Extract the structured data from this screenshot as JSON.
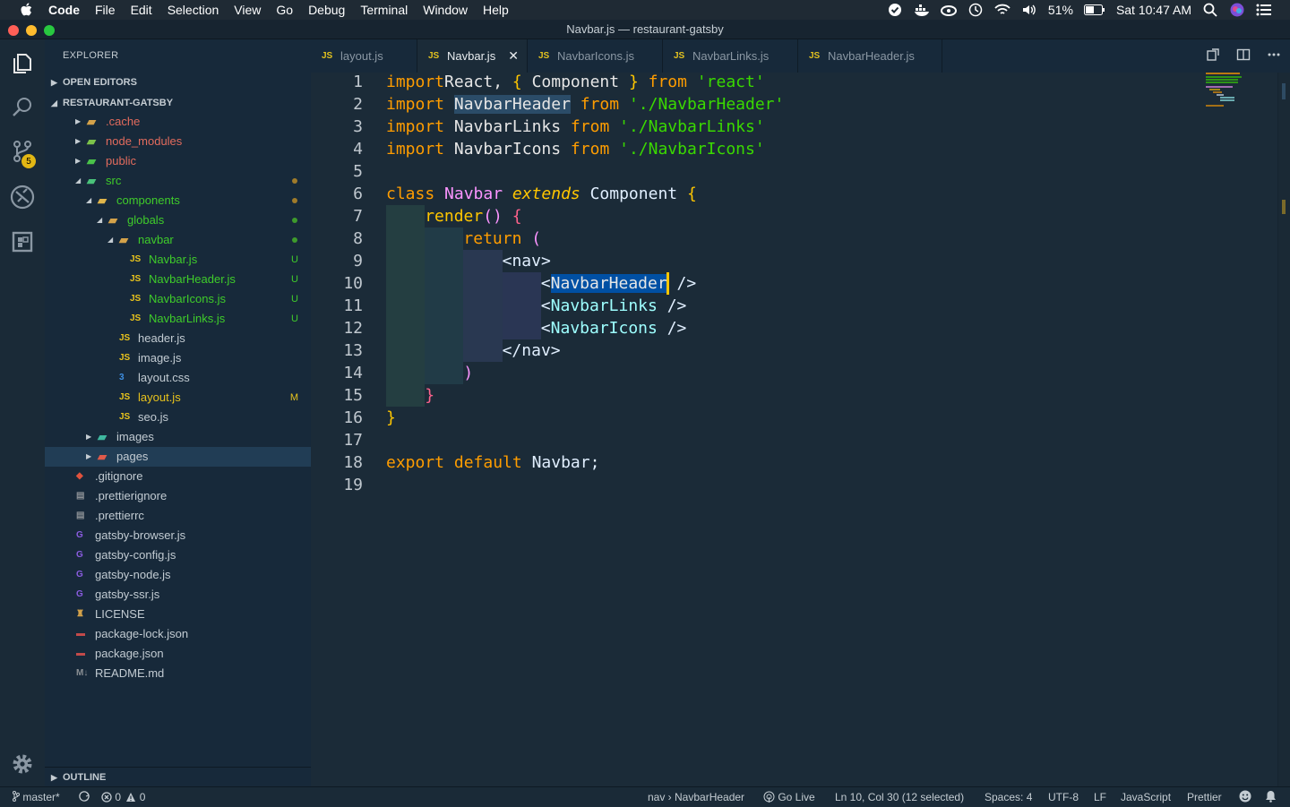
{
  "menubar": {
    "app": "Code",
    "items": [
      "File",
      "Edit",
      "Selection",
      "View",
      "Go",
      "Debug",
      "Terminal",
      "Window",
      "Help"
    ],
    "battery": "51%",
    "clock": "Sat 10:47 AM"
  },
  "window": {
    "title": "Navbar.js — restaurant-gatsby"
  },
  "activity": {
    "scm_badge": "5"
  },
  "explorer": {
    "title": "EXPLORER",
    "open_editors": "OPEN EDITORS",
    "project": "RESTAURANT-GATSBY",
    "outline": "OUTLINE",
    "tree": [
      {
        "name": ".cache",
        "icon": "folder-icon",
        "color": "#e26b5d",
        "expand": "closed",
        "status": "",
        "dot": ""
      },
      {
        "name": "node_modules",
        "icon": "node-folder-icon",
        "color": "#e26b5d",
        "expand": "closed",
        "status": "",
        "dot": ""
      },
      {
        "name": "public",
        "icon": "public-folder-icon",
        "color": "#e26b5d",
        "expand": "closed",
        "status": "",
        "dot": ""
      },
      {
        "name": "src",
        "icon": "src-folder-icon",
        "color": "#3fcc2a",
        "expand": "open",
        "status": "",
        "dot": "#a07b2a"
      },
      {
        "name": "components",
        "icon": "components-folder-icon",
        "color": "#3fcc2a",
        "expand": "open",
        "status": "",
        "dot": "#a07b2a"
      },
      {
        "name": "globals",
        "icon": "folder-icon",
        "color": "#3fcc2a",
        "expand": "open",
        "status": "",
        "dot": "#3e9a2c"
      },
      {
        "name": "navbar",
        "icon": "folder-icon",
        "color": "#3fcc2a",
        "expand": "open",
        "status": "",
        "dot": "#3e9a2c"
      },
      {
        "name": "Navbar.js",
        "icon": "js-file-icon",
        "color": "#3fcc2a",
        "expand": "",
        "status": "U",
        "dot": ""
      },
      {
        "name": "NavbarHeader.js",
        "icon": "js-file-icon",
        "color": "#3fcc2a",
        "expand": "",
        "status": "U",
        "dot": ""
      },
      {
        "name": "NavbarIcons.js",
        "icon": "js-file-icon",
        "color": "#3fcc2a",
        "expand": "",
        "status": "U",
        "dot": ""
      },
      {
        "name": "NavbarLinks.js",
        "icon": "js-file-icon",
        "color": "#3fcc2a",
        "expand": "",
        "status": "U",
        "dot": ""
      },
      {
        "name": "header.js",
        "icon": "js-file-icon",
        "color": "#c2cbd2",
        "expand": "",
        "status": "",
        "dot": ""
      },
      {
        "name": "image.js",
        "icon": "js-file-icon",
        "color": "#c2cbd2",
        "expand": "",
        "status": "",
        "dot": ""
      },
      {
        "name": "layout.css",
        "icon": "css-file-icon",
        "color": "#c2cbd2",
        "expand": "",
        "status": "",
        "dot": ""
      },
      {
        "name": "layout.js",
        "icon": "js-file-icon",
        "color": "#e8c31d",
        "expand": "",
        "status": "M",
        "dot": ""
      },
      {
        "name": "seo.js",
        "icon": "js-file-icon",
        "color": "#c2cbd2",
        "expand": "",
        "status": "",
        "dot": ""
      },
      {
        "name": "images",
        "icon": "images-folder-icon",
        "color": "#c2cbd2",
        "expand": "closed",
        "status": "",
        "dot": ""
      },
      {
        "name": "pages",
        "icon": "pages-folder-icon",
        "color": "#c2cbd2",
        "expand": "closed",
        "status": "",
        "dot": ""
      },
      {
        "name": ".gitignore",
        "icon": "git-icon",
        "color": "#c2cbd2",
        "expand": "",
        "status": "",
        "dot": ""
      },
      {
        "name": ".prettierignore",
        "icon": "prettier-icon",
        "color": "#c2cbd2",
        "expand": "",
        "status": "",
        "dot": ""
      },
      {
        "name": ".prettierrc",
        "icon": "prettier-icon",
        "color": "#c2cbd2",
        "expand": "",
        "status": "",
        "dot": ""
      },
      {
        "name": "gatsby-browser.js",
        "icon": "gatsby-icon",
        "color": "#c2cbd2",
        "expand": "",
        "status": "",
        "dot": ""
      },
      {
        "name": "gatsby-config.js",
        "icon": "gatsby-icon",
        "color": "#c2cbd2",
        "expand": "",
        "status": "",
        "dot": ""
      },
      {
        "name": "gatsby-node.js",
        "icon": "gatsby-icon",
        "color": "#c2cbd2",
        "expand": "",
        "status": "",
        "dot": ""
      },
      {
        "name": "gatsby-ssr.js",
        "icon": "gatsby-icon",
        "color": "#c2cbd2",
        "expand": "",
        "status": "",
        "dot": ""
      },
      {
        "name": "LICENSE",
        "icon": "license-icon",
        "color": "#c2cbd2",
        "expand": "",
        "status": "",
        "dot": ""
      },
      {
        "name": "package-lock.json",
        "icon": "npm-icon",
        "color": "#c2cbd2",
        "expand": "",
        "status": "",
        "dot": ""
      },
      {
        "name": "package.json",
        "icon": "npm-icon",
        "color": "#c2cbd2",
        "expand": "",
        "status": "",
        "dot": ""
      },
      {
        "name": "README.md",
        "icon": "markdown-icon",
        "color": "#c2cbd2",
        "expand": "",
        "status": "",
        "dot": ""
      }
    ]
  },
  "tabs": [
    {
      "label": "layout.js",
      "active": false
    },
    {
      "label": "Navbar.js",
      "active": true
    },
    {
      "label": "NavbarIcons.js",
      "active": false
    },
    {
      "label": "NavbarLinks.js",
      "active": false
    },
    {
      "label": "NavbarHeader.js",
      "active": false
    }
  ],
  "code": {
    "line_numbers": [
      "1",
      "2",
      "3",
      "4",
      "5",
      "6",
      "7",
      "8",
      "9",
      "10",
      "11",
      "12",
      "13",
      "14",
      "15",
      "16",
      "17",
      "18",
      "19"
    ],
    "lines": [
      [
        [
          "kw",
          "import"
        ],
        [
          "",
          "React, "
        ],
        [
          "brp",
          "{"
        ],
        [
          "",
          ""
        ],
        [
          "",
          "Component "
        ],
        [
          "brp",
          "}"
        ],
        [
          "kw",
          " from"
        ],
        [
          "str",
          " 'react'"
        ]
      ],
      [
        [
          "kw",
          "import"
        ],
        [
          "",
          ""
        ],
        [
          "hlw",
          "NavbarHeader"
        ],
        [
          "kw",
          " from"
        ],
        [
          "str",
          " './NavbarHeader'"
        ]
      ],
      [
        [
          "kw",
          "import"
        ],
        [
          "",
          ""
        ],
        [
          "",
          "NavbarLinks"
        ],
        [
          "kw",
          " from"
        ],
        [
          "str",
          " './NavbarLinks'"
        ]
      ],
      [
        [
          "kw",
          "import"
        ],
        [
          "",
          ""
        ],
        [
          "",
          "NavbarIcons"
        ],
        [
          "kw",
          " from"
        ],
        [
          "str",
          " './NavbarIcons'"
        ]
      ],
      [],
      [
        [
          "kw",
          "class"
        ],
        [
          "cls",
          " Navbar"
        ],
        [
          "ext",
          " extends"
        ],
        [
          "pun",
          " Component"
        ],
        [
          "brp",
          " {"
        ]
      ],
      [
        [
          "fn",
          "render"
        ],
        [
          "cls",
          "()"
        ],
        [
          "brpu",
          " {"
        ]
      ],
      [
        [
          "kw",
          "return"
        ],
        [
          "cls",
          " ("
        ]
      ],
      [
        [
          "pun",
          "<"
        ],
        [
          "pun",
          "nav"
        ],
        [
          "pun",
          ">"
        ]
      ],
      [
        [
          "pun",
          "<"
        ],
        [
          "sel",
          "NavbarHeader"
        ],
        [
          "pun",
          " />"
        ]
      ],
      [
        [
          "pun",
          "<"
        ],
        [
          "tag",
          "NavbarLinks"
        ],
        [
          "pun",
          " />"
        ]
      ],
      [
        [
          "pun",
          "<"
        ],
        [
          "tag",
          "NavbarIcons"
        ],
        [
          "pun",
          " />"
        ]
      ],
      [
        [
          "pun",
          "</"
        ],
        [
          "pun",
          "nav"
        ],
        [
          "pun",
          ">"
        ]
      ],
      [
        [
          "cls",
          ")"
        ]
      ],
      [
        [
          "brpu",
          "}"
        ]
      ],
      [
        [
          "brp",
          "}"
        ]
      ],
      [],
      [
        [
          "kw",
          "export"
        ],
        [
          "kw",
          " default"
        ],
        [
          "pun",
          " Navbar;"
        ]
      ],
      []
    ]
  },
  "status": {
    "branch": "master*",
    "errors": "0",
    "warnings": "0",
    "breadcrumb": "nav › NavbarHeader",
    "golive": "Go Live",
    "position": "Ln 10, Col 30 (12 selected)",
    "spaces": "Spaces: 4",
    "encoding": "UTF-8",
    "eol": "LF",
    "language": "JavaScript",
    "formatter": "Prettier"
  }
}
